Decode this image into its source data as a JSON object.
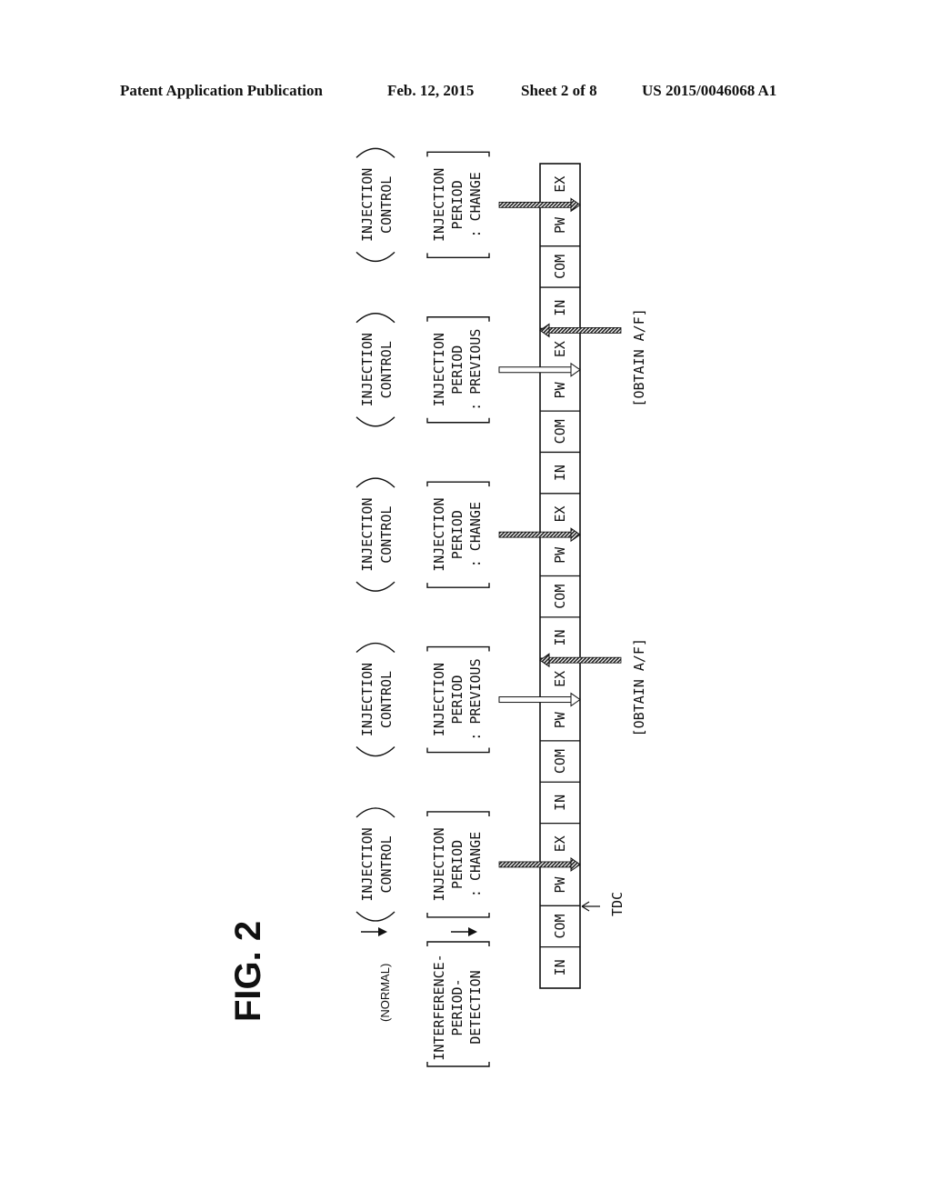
{
  "header": {
    "publication": "Patent Application Publication",
    "date": "Feb. 12, 2015",
    "sheet": "Sheet 2 of 8",
    "number": "US 2015/0046068 A1"
  },
  "figure": {
    "title": "FIG. 2",
    "row_labels": {
      "normal": "(NORMAL)",
      "detection": [
        "INTERFERENCE-",
        "PERIOD-",
        "DETECTION"
      ]
    },
    "stroke_sequence": [
      "IN",
      "COM",
      "PW",
      "EX",
      "IN",
      "COM",
      "PW",
      "EX",
      "IN",
      "COM",
      "PW",
      "EX",
      "IN",
      "COM",
      "PW",
      "EX",
      "IN",
      "COM",
      "PW",
      "EX"
    ],
    "tdc_label": "TDC",
    "control_groups": [
      {
        "control": [
          "INJECTION",
          "CONTROL"
        ],
        "period": [
          "INJECTION",
          "PERIOD",
          ": CHANGE"
        ],
        "arrow_type": "change",
        "target_cell": 3
      },
      {
        "control": [
          "INJECTION",
          "CONTROL"
        ],
        "period": [
          "INJECTION",
          "PERIOD",
          ": PREVIOUS"
        ],
        "arrow_type": "previous",
        "target_cell": 7
      },
      {
        "control": [
          "INJECTION",
          "CONTROL"
        ],
        "period": [
          "INJECTION",
          "PERIOD",
          ": CHANGE"
        ],
        "arrow_type": "change",
        "target_cell": 11
      },
      {
        "control": [
          "INJECTION",
          "CONTROL"
        ],
        "period": [
          "INJECTION",
          "PERIOD",
          ": PREVIOUS"
        ],
        "arrow_type": "previous",
        "target_cell": 15
      },
      {
        "control": [
          "INJECTION",
          "CONTROL"
        ],
        "period": [
          "INJECTION",
          "PERIOD",
          ": CHANGE"
        ],
        "arrow_type": "change",
        "target_cell": 19
      }
    ],
    "obtain_af": [
      {
        "label": "[OBTAIN A/F]",
        "boundary_after_cell": 7
      },
      {
        "label": "[OBTAIN A/F]",
        "boundary_after_cell": 15
      }
    ]
  }
}
